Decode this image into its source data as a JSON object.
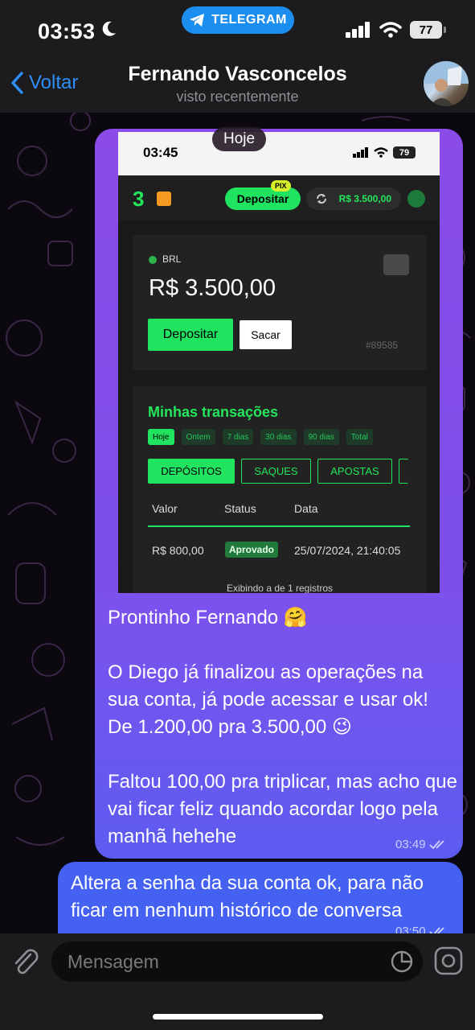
{
  "status_bar": {
    "time": "03:53",
    "source_app": "TELEGRAM",
    "battery": "77"
  },
  "header": {
    "back_label": "Voltar",
    "contact_name": "Fernando Vasconcelos",
    "contact_status": "visto recentemente"
  },
  "date_badge": "Hoje",
  "screenshot": {
    "status_time": "03:45",
    "status_battery": "79",
    "logo": "3",
    "deposit_label": "Depositar",
    "pix_label": "PIX",
    "balance_pill": "R$ 3.500,00",
    "currency": "BRL",
    "balance": "R$ 3.500,00",
    "btn_deposit": "Depositar",
    "btn_withdraw": "Sacar",
    "account_id": "#89585",
    "transactions_title": "Minhas transações",
    "filters": [
      "Hoje",
      "Ontem",
      "7 dias",
      "30 dias",
      "90 dias",
      "Total"
    ],
    "tabs": [
      "DEPÓSITOS",
      "SAQUES",
      "APOSTAS"
    ],
    "table_headers": [
      "Valor",
      "Status",
      "Data"
    ],
    "row": {
      "value": "R$ 800,00",
      "status": "Aprovado",
      "date": "25/07/2024, 21:40:05"
    },
    "footer": "Exibindo a de 1 registros"
  },
  "messages": [
    {
      "text": "Prontinho Fernando 🤗\n\nO Diego já finalizou as operações na sua conta, já pode acessar e usar ok! De 1.200,00 pra 3.500,00 😉\n\nFaltou 100,00 pra triplicar, mas acho que vai ficar feliz quando acordar logo pela manhã hehehe",
      "time": "03:49"
    },
    {
      "text": "Altera a senha da sua conta ok, para não ficar em nenhum histórico de conversa",
      "time": "03:50"
    }
  ],
  "composer": {
    "placeholder": "Mensagem"
  },
  "colors": {
    "accent_blue": "#2d8ef5",
    "bubble_purple": "#7d52ee",
    "bubble_blue": "#4561f2",
    "neon_green": "#20e360"
  },
  "icons": [
    "moon-icon",
    "telegram-icon",
    "signal-icon",
    "wifi-icon",
    "chevron-left-icon",
    "paperclip-icon",
    "sticker-icon",
    "camera-icon",
    "double-check-icon"
  ]
}
